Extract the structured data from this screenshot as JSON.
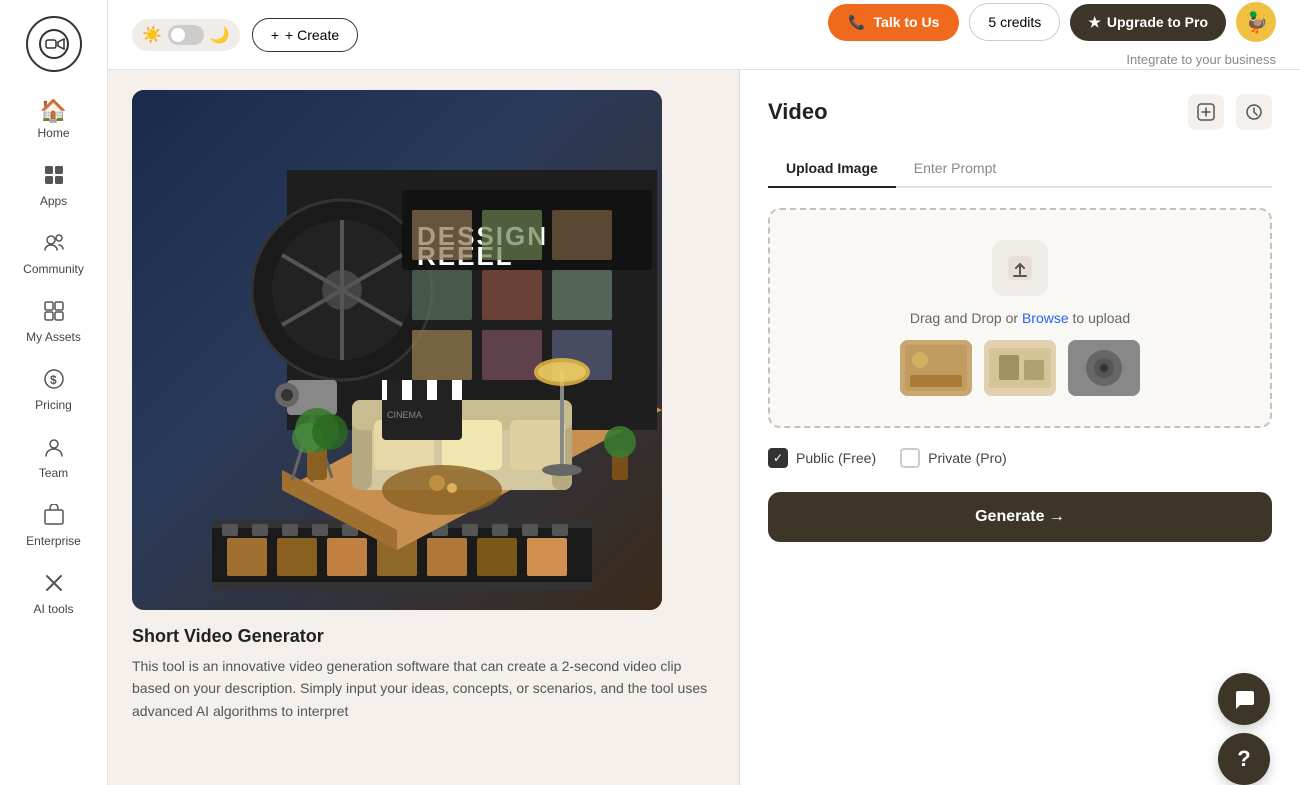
{
  "sidebar": {
    "logo_label": "Logo",
    "items": [
      {
        "id": "home",
        "label": "Home",
        "icon": "🏠"
      },
      {
        "id": "apps",
        "label": "Apps",
        "icon": "⊞"
      },
      {
        "id": "community",
        "label": "Community",
        "icon": "👥"
      },
      {
        "id": "my-assets",
        "label": "My Assets",
        "icon": "⊞"
      },
      {
        "id": "pricing",
        "label": "Pricing",
        "icon": "$"
      },
      {
        "id": "team",
        "label": "Team",
        "icon": "👤"
      },
      {
        "id": "enterprise",
        "label": "Enterprise",
        "icon": "⊞"
      },
      {
        "id": "ai-tools",
        "label": "AI tools",
        "icon": "✕"
      }
    ]
  },
  "header": {
    "theme_toggle": {
      "sun_icon": "☀",
      "moon_icon": "🌙"
    },
    "create_button": "+ Create",
    "talk_button": "Talk to Us",
    "credits_button": "5 credits",
    "upgrade_button": "Upgrade to Pro",
    "integrate_text": "Integrate to your business",
    "avatar_emoji": "🦆"
  },
  "left_panel": {
    "video_title": "Short Video Generator",
    "video_description": "This tool is an innovative video generation software that can create a 2-second video clip based on your description. Simply input your ideas, concepts, or scenarios, and the tool uses advanced AI algorithms to interpret"
  },
  "right_panel": {
    "title": "Video",
    "tabs": [
      {
        "id": "upload-image",
        "label": "Upload Image",
        "active": true
      },
      {
        "id": "enter-prompt",
        "label": "Enter Prompt",
        "active": false
      }
    ],
    "upload": {
      "icon": "⬆",
      "drag_text": "Drag and Drop or ",
      "browse_text": "Browse",
      "after_text": " to upload"
    },
    "checkboxes": [
      {
        "id": "public",
        "label": "Public (Free)",
        "checked": true
      },
      {
        "id": "private",
        "label": "Private (Pro)",
        "checked": false
      }
    ],
    "generate_button": "Generate →"
  },
  "colors": {
    "orange": "#f06a1e",
    "dark_brown": "#3d3528",
    "accent_blue": "#2563eb"
  }
}
